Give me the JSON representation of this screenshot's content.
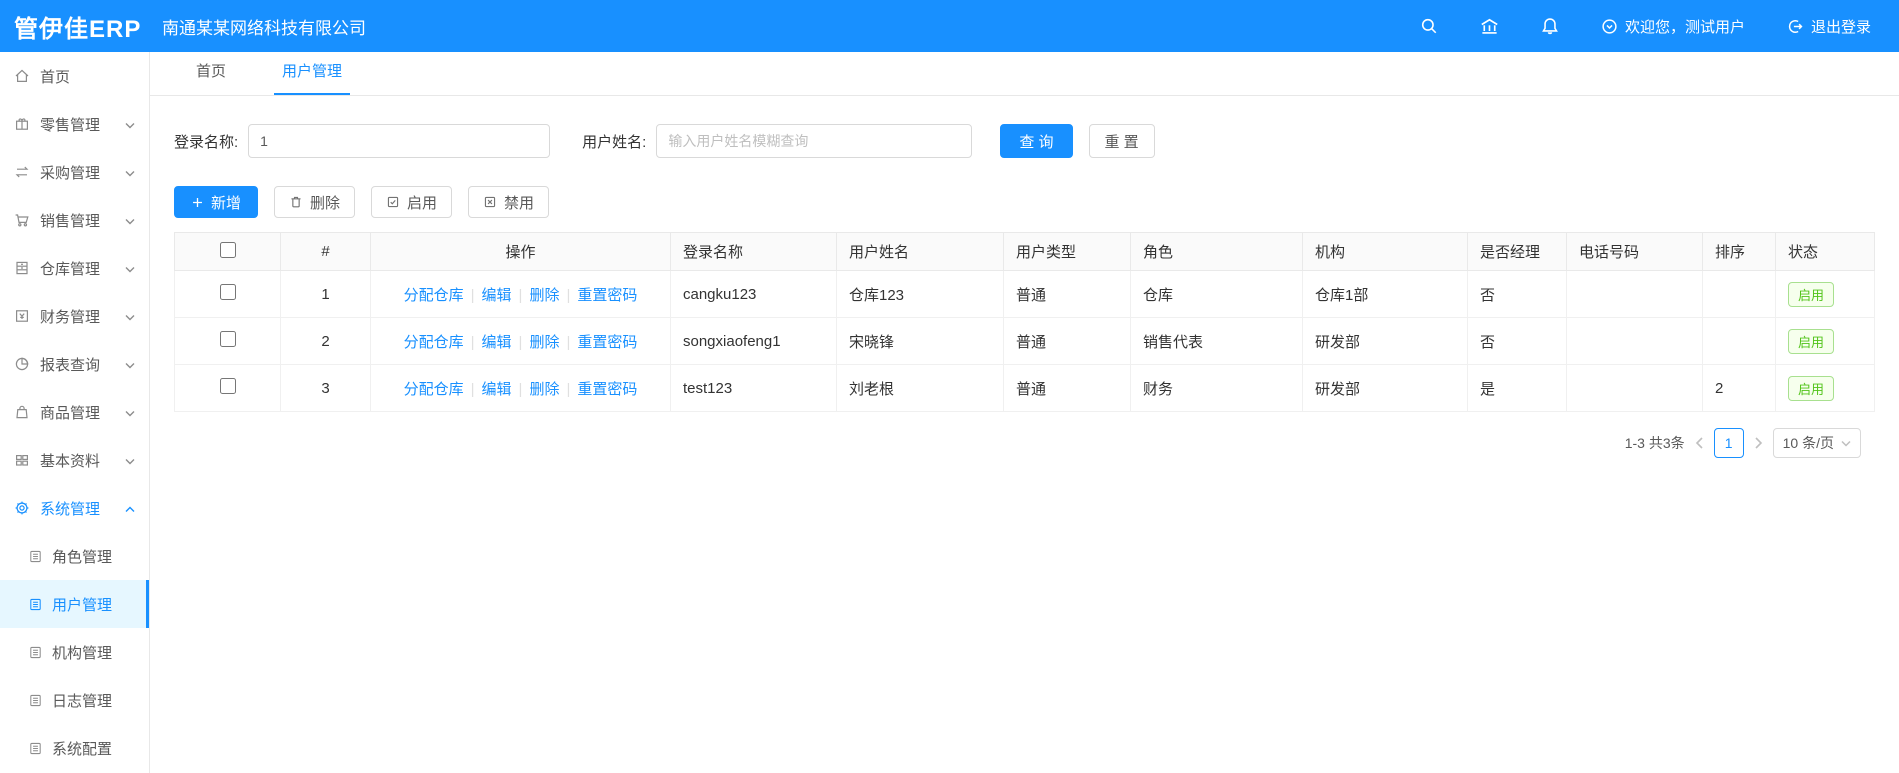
{
  "header": {
    "logo": "管伊佳ERP",
    "company": "南通某某网络科技有限公司",
    "welcome": "欢迎您，测试用户",
    "logout": "退出登录"
  },
  "sidebar": {
    "items": [
      {
        "label": "首页"
      },
      {
        "label": "零售管理"
      },
      {
        "label": "采购管理"
      },
      {
        "label": "销售管理"
      },
      {
        "label": "仓库管理"
      },
      {
        "label": "财务管理"
      },
      {
        "label": "报表查询"
      },
      {
        "label": "商品管理"
      },
      {
        "label": "基本资料"
      },
      {
        "label": "系统管理"
      }
    ],
    "sub_items": [
      {
        "label": "角色管理"
      },
      {
        "label": "用户管理"
      },
      {
        "label": "机构管理"
      },
      {
        "label": "日志管理"
      },
      {
        "label": "系统配置"
      }
    ]
  },
  "tabs": [
    {
      "label": "首页"
    },
    {
      "label": "用户管理"
    }
  ],
  "filter": {
    "login_label": "登录名称:",
    "login_value": "1",
    "name_label": "用户姓名:",
    "name_placeholder": "输入用户姓名模糊查询",
    "search_label": "查 询",
    "reset_label": "重 置"
  },
  "toolbar": {
    "add_label": "新增",
    "delete_label": "删除",
    "enable_label": "启用",
    "disable_label": "禁用"
  },
  "table": {
    "columns": [
      "#",
      "操作",
      "登录名称",
      "用户姓名",
      "用户类型",
      "角色",
      "机构",
      "是否经理",
      "电话号码",
      "排序",
      "状态"
    ],
    "row_actions": [
      "分配仓库",
      "编辑",
      "删除",
      "重置密码"
    ],
    "rows": [
      {
        "index": "1",
        "login": "cangku123",
        "name": "仓库123",
        "type": "普通",
        "role": "仓库",
        "org": "仓库1部",
        "manager": "否",
        "phone": "",
        "sort": "",
        "status": "启用"
      },
      {
        "index": "2",
        "login": "songxiaofeng1",
        "name": "宋晓锋",
        "type": "普通",
        "role": "销售代表",
        "org": "研发部",
        "manager": "否",
        "phone": "",
        "sort": "",
        "status": "启用"
      },
      {
        "index": "3",
        "login": "test123",
        "name": "刘老根",
        "type": "普通",
        "role": "财务",
        "org": "研发部",
        "manager": "是",
        "phone": "",
        "sort": "2",
        "status": "启用"
      }
    ]
  },
  "pagination": {
    "total_text": "1-3 共3条",
    "current_page": "1",
    "page_size": "10 条/页"
  },
  "colors": {
    "primary": "#1890ff",
    "success": "#52c41a"
  }
}
